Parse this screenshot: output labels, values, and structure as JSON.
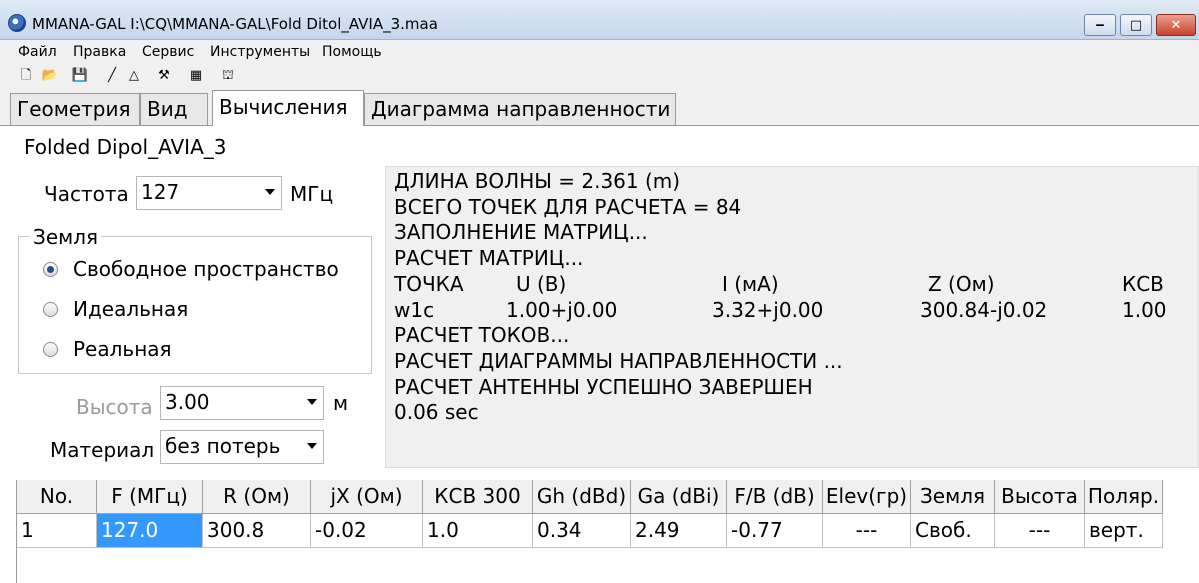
{
  "window": {
    "title": "MMANA-GAL I:\\CQ\\MMANA-GAL\\Fold Ditol_AVIA_3.maa",
    "controls": {
      "minimize": "‒",
      "maximize": "□",
      "close": "✕"
    }
  },
  "menu": [
    "Файл",
    "Правка",
    "Сервис",
    "Инструменты",
    "Помощь"
  ],
  "toolbar": [
    {
      "name": "new-file-icon",
      "glyph": "🗋"
    },
    {
      "name": "open-folder-icon",
      "glyph": "📂"
    },
    {
      "name": "save-icon",
      "glyph": "💾"
    },
    {
      "name": "line-icon",
      "glyph": "╱"
    },
    {
      "name": "triangle-icon",
      "glyph": "△"
    },
    {
      "name": "tools-icon",
      "glyph": "⚒"
    },
    {
      "name": "calculator-icon",
      "glyph": "▦"
    },
    {
      "name": "antenna-icon",
      "glyph": "⛫"
    }
  ],
  "tabs": [
    "Геометрия",
    "Вид",
    "Вычисления",
    "Диаграмма направленности"
  ],
  "active_tab": 2,
  "project_title": "Folded Dipol_AVIA_3",
  "frequency": {
    "label": "Частота",
    "value": "127",
    "unit": "МГц"
  },
  "ground": {
    "label": "Земля",
    "options": [
      "Свободное пространство",
      "Идеальная",
      "Реальная"
    ],
    "selected": 0
  },
  "height": {
    "label": "Высота",
    "value": "3.00",
    "unit": "м"
  },
  "material": {
    "label": "Материал",
    "value": "без потерь"
  },
  "log": {
    "lines_top": [
      "ДЛИНА ВОЛНЫ = 2.361 (m)",
      "ВСЕГО ТОЧЕК ДЛЯ РАСЧЕТА = 84",
      "ЗАПОЛНЕНИЕ МАТРИЦ...",
      "РАСЧЕТ МАТРИЦ..."
    ],
    "header_row": [
      "ТОЧКА",
      "U (В)",
      "I (мА)",
      "Z (Ом)",
      "КСВ"
    ],
    "data_row": [
      "w1c",
      "1.00+j0.00",
      "3.32+j0.00",
      "300.84-j0.02",
      "1.00"
    ],
    "lines_bottom": [
      "РАСЧЕТ ТОКОВ...",
      "РАСЧЕТ ДИАГРАММЫ НАПРАВЛЕННОСТИ ...",
      "РАСЧЕТ АНТЕННЫ УСПЕШНО ЗАВЕРШЕН",
      "0.06 sec"
    ]
  },
  "results": {
    "columns": [
      "No.",
      "F (МГц)",
      "R (Ом)",
      "jX (Ом)",
      "КСВ 300",
      "Gh (dBd)",
      "Ga (dBi)",
      "F/B (dB)",
      "Elev(гр)",
      "Земля",
      "Высота",
      "Поляр."
    ],
    "rows": [
      [
        "1",
        "127.0",
        "300.8",
        "-0.02",
        "1.0",
        "0.34",
        "2.49",
        "-0.77",
        "---",
        "Своб.",
        "---",
        "верт."
      ]
    ]
  }
}
